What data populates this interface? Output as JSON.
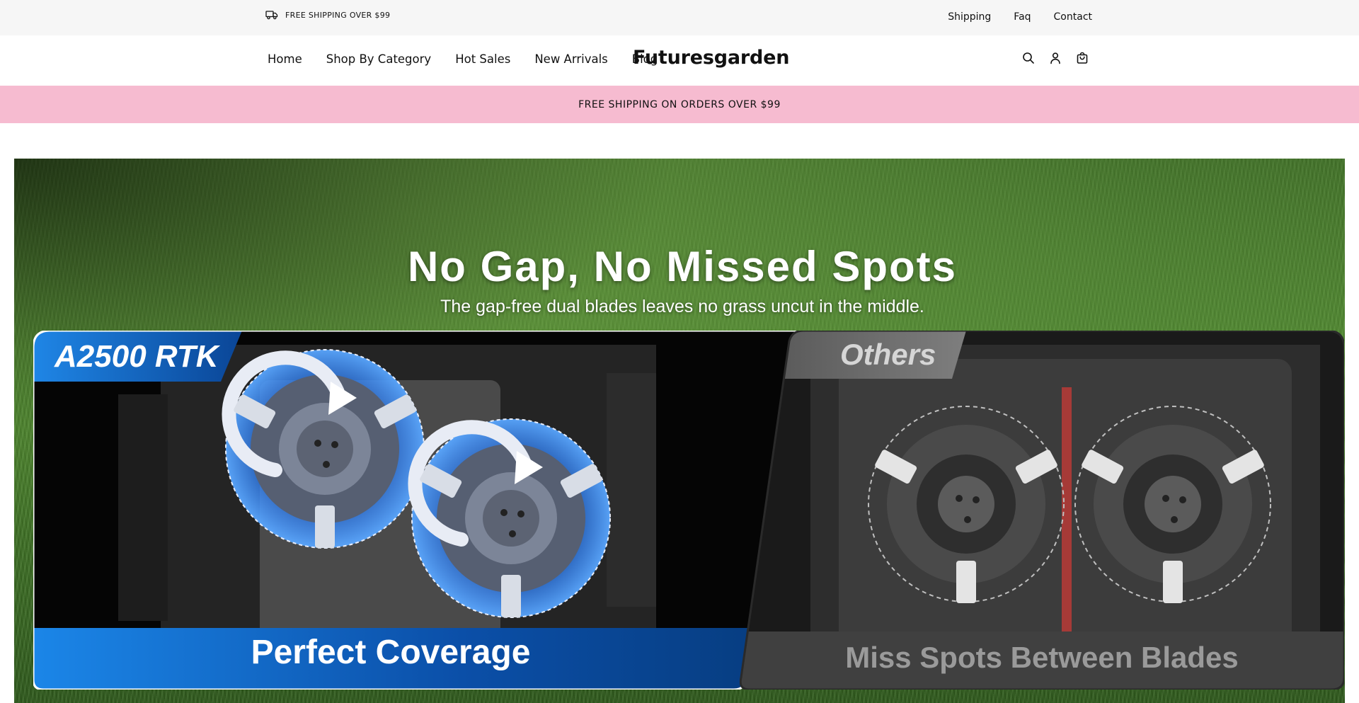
{
  "topbar": {
    "shipping_notice": "FREE SHIPPING OVER $99",
    "links": [
      "Shipping",
      "Faq",
      "Contact"
    ]
  },
  "header": {
    "nav": [
      "Home",
      "Shop By Category",
      "Hot Sales",
      "New Arrivals",
      "Blog"
    ],
    "logo": "Futuresgarden",
    "icons": [
      "search-icon",
      "account-icon",
      "cart-icon"
    ]
  },
  "promo": {
    "text": "FREE SHIPPING ON ORDERS OVER $99",
    "background": "#f6bbd0"
  },
  "hero": {
    "headline": "No Gap, No Missed Spots",
    "subline": "The gap-free dual blades leaves no grass uncut in the middle.",
    "left_panel": {
      "label": "A2500 RTK",
      "caption": "Perfect Coverage",
      "accent": "#1a6fd6"
    },
    "right_panel": {
      "label": "Others",
      "caption": "Miss Spots Between Blades",
      "gap_color": "#e0312b"
    }
  }
}
